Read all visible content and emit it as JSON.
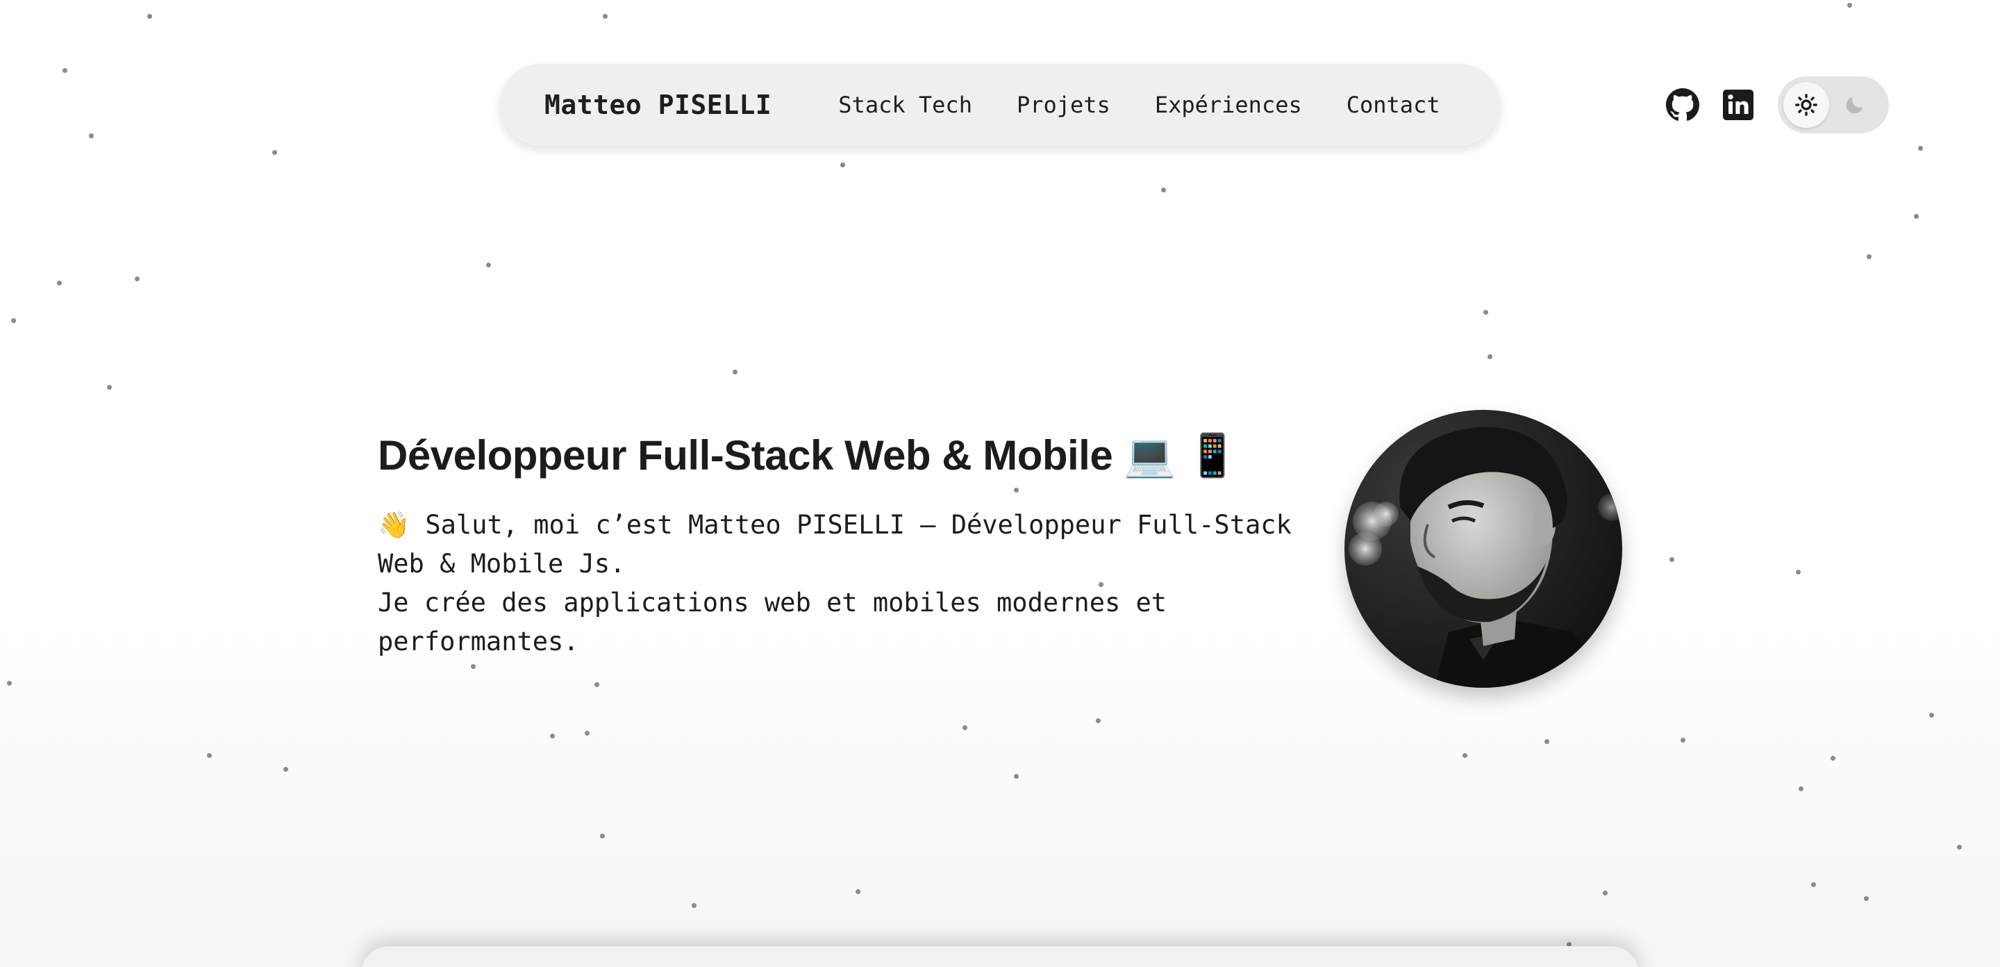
{
  "nav": {
    "brand": "Matteo PISELLI",
    "links": [
      {
        "label": "Stack Tech"
      },
      {
        "label": "Projets"
      },
      {
        "label": "Expériences"
      },
      {
        "label": "Contact"
      }
    ]
  },
  "social": {
    "github_icon": "github-icon",
    "linkedin_icon": "linkedin-icon"
  },
  "theme_toggle": {
    "options": [
      "sun-icon",
      "moon-icon"
    ],
    "selected": "light"
  },
  "hero": {
    "title": "Développeur Full-Stack Web & Mobile 💻 📱",
    "intro_lines": [
      "👋 Salut, moi c’est Matteo PISELLI – Développeur Full-Stack",
      "Web & Mobile Js.",
      "Je crée des applications web et mobiles modernes et",
      "performantes."
    ]
  },
  "colors": {
    "background": "#ffffff",
    "nav_bg": "#efefef",
    "text": "#1c1c1c",
    "dots": "#8a8a8a"
  }
}
